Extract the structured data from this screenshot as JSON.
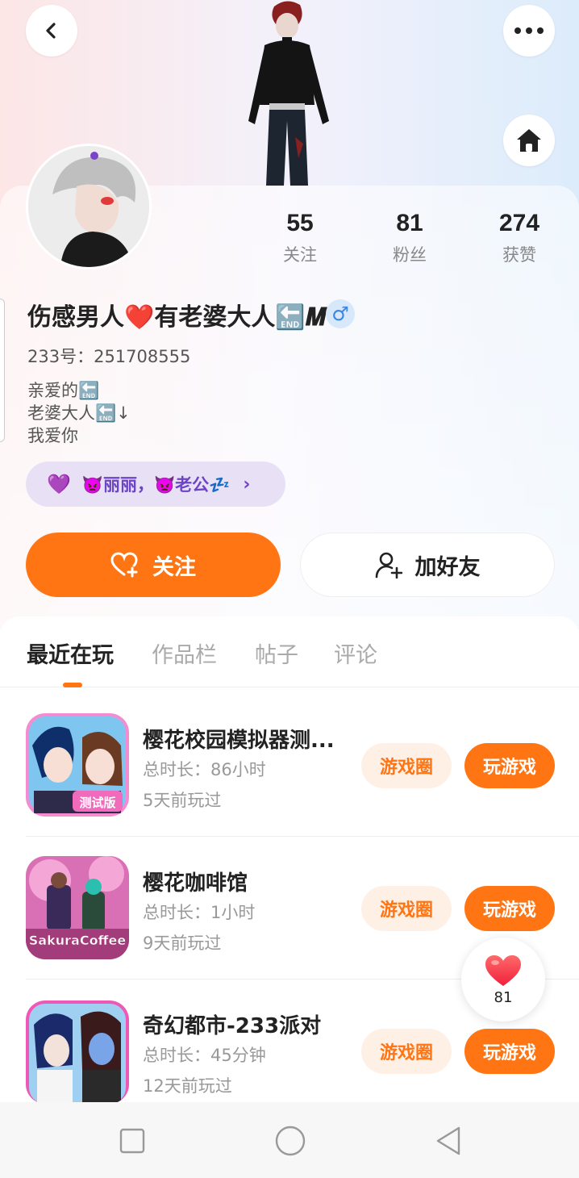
{
  "stats": [
    {
      "value": "55",
      "label": "关注"
    },
    {
      "value": "81",
      "label": "粉丝"
    },
    {
      "value": "274",
      "label": "获赞"
    }
  ],
  "profile": {
    "name": "伤感男人❤️有老婆大人🔚𝑴",
    "gender_symbol": "♂",
    "id_line": "233号：251708555",
    "bio": [
      "亲爱的🔚",
      "老婆大人🔚↓",
      "我爱你"
    ]
  },
  "relation": {
    "hearts": "💜",
    "text": "👿丽丽，👿老公💤",
    "chevron": "›"
  },
  "actions": {
    "follow_label": "关注",
    "add_friend_label": "加好友"
  },
  "tabs": [
    {
      "label": "最近在玩",
      "active": true
    },
    {
      "label": "作品栏",
      "active": false
    },
    {
      "label": "帖子",
      "active": false
    },
    {
      "label": "评论",
      "active": false
    }
  ],
  "games": [
    {
      "title": "樱花校园模拟器测...",
      "duration": "总时长：86小时",
      "last_played": "5天前玩过",
      "circle_label": "游戏圈",
      "play_label": "玩游戏",
      "icon": "sakura-school-icon",
      "badge": "测试版"
    },
    {
      "title": "樱花咖啡馆",
      "duration": "总时长：1小时",
      "last_played": "9天前玩过",
      "circle_label": "游戏圈",
      "play_label": "玩游戏",
      "icon": "sakura-coffee-icon",
      "badge": "SakuraCoffee"
    },
    {
      "title": "奇幻都市-233派对",
      "duration": "总时长：45分钟",
      "last_played": "12天前玩过",
      "circle_label": "游戏圈",
      "play_label": "玩游戏",
      "icon": "fantasy-city-icon",
      "badge": ""
    }
  ],
  "like_float": {
    "count": "81"
  },
  "colors": {
    "accent": "#ff7513",
    "accent_soft": "#fff0e6",
    "relation_bg": "#e8e1f6",
    "relation_text": "#6e44c6"
  }
}
